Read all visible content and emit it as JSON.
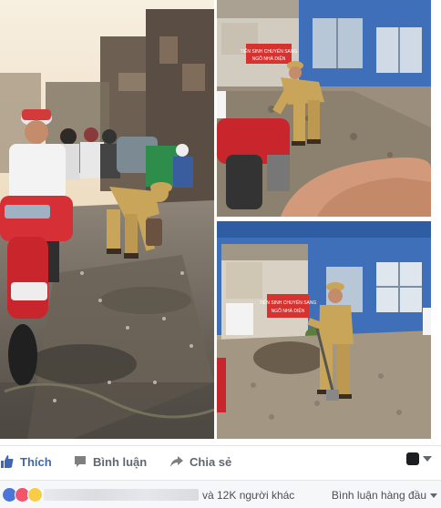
{
  "actions": {
    "like_label": "Thích",
    "comment_label": "Bình luận",
    "share_label": "Chia sẻ"
  },
  "reactions": {
    "icons": [
      "like-icon",
      "love-icon",
      "wow-icon"
    ],
    "count_text": "và 12K người khác",
    "sort_label": "Bình luận hàng đầu"
  },
  "photos": {
    "sign_text_1": "TIẾN SINH CHUYỂN SANG",
    "sign_text_2": "NGÕ NHÀ DIỆN"
  },
  "colors": {
    "accent": "#4267b2",
    "police_uniform": "#c9a55a",
    "sign_red": "#d6322f",
    "building_blue": "#3f6fb8"
  }
}
